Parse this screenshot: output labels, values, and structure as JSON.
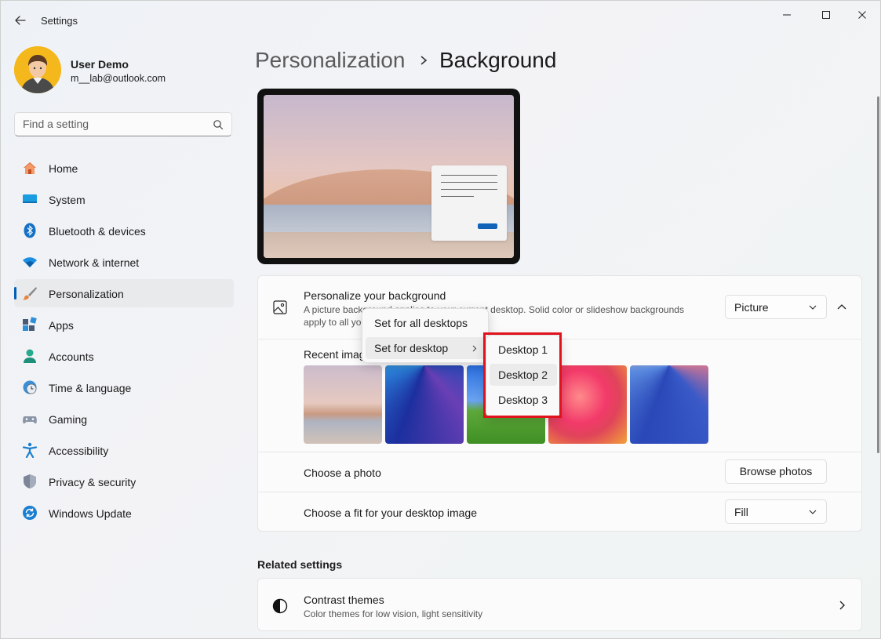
{
  "app": {
    "title": "Settings"
  },
  "window_controls": {
    "minimize": "—",
    "maximize": "☐",
    "close": "✕"
  },
  "user": {
    "name": "User Demo",
    "email": "m__lab@outlook.com"
  },
  "search": {
    "placeholder": "Find a setting"
  },
  "nav": {
    "items": [
      {
        "label": "Home",
        "icon": "home-icon"
      },
      {
        "label": "System",
        "icon": "system-icon"
      },
      {
        "label": "Bluetooth & devices",
        "icon": "bluetooth-icon"
      },
      {
        "label": "Network & internet",
        "icon": "wifi-icon"
      },
      {
        "label": "Personalization",
        "icon": "brush-icon",
        "active": true
      },
      {
        "label": "Apps",
        "icon": "apps-icon"
      },
      {
        "label": "Accounts",
        "icon": "accounts-icon"
      },
      {
        "label": "Time & language",
        "icon": "clock-globe-icon"
      },
      {
        "label": "Gaming",
        "icon": "gamepad-icon"
      },
      {
        "label": "Accessibility",
        "icon": "accessibility-icon"
      },
      {
        "label": "Privacy & security",
        "icon": "shield-icon"
      },
      {
        "label": "Windows Update",
        "icon": "update-icon"
      }
    ]
  },
  "breadcrumb": {
    "parent": "Personalization",
    "current": "Background"
  },
  "personalize": {
    "title": "Personalize your background",
    "desc_line1": "A picture background applies to your current desktop. Solid color or slideshow backgrounds",
    "desc_line2": "apply to all your desktops.",
    "dropdown_value": "Picture"
  },
  "recent": {
    "label": "Recent images"
  },
  "photo_row": {
    "label": "Choose a photo",
    "button": "Browse photos"
  },
  "fit_row": {
    "label": "Choose a fit for your desktop image",
    "dropdown_value": "Fill"
  },
  "related": {
    "label": "Related settings",
    "contrast_title": "Contrast themes",
    "contrast_desc": "Color themes for low vision, light sensitivity"
  },
  "context_menu": {
    "items": [
      "Set for all desktops",
      "Set for desktop"
    ]
  },
  "submenu": {
    "items": [
      "Desktop 1",
      "Desktop 2",
      "Desktop 3"
    ],
    "hovered": "Desktop 2"
  },
  "colors": {
    "accent": "#005fb8",
    "highlight": "#e0121b"
  }
}
